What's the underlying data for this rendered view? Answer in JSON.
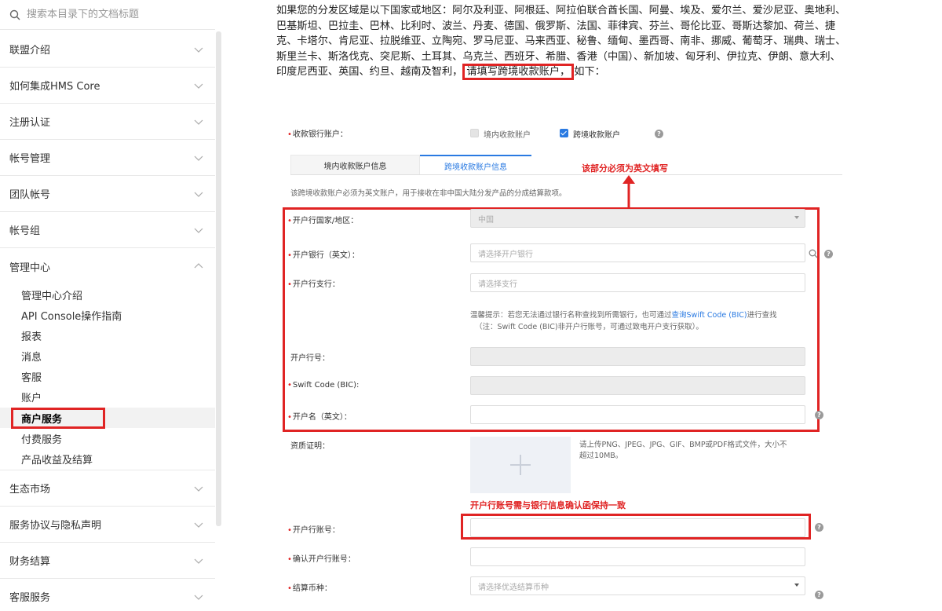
{
  "sidebar": {
    "search_placeholder": "搜索本目录下的文档标题",
    "items": [
      {
        "label": "联盟介绍"
      },
      {
        "label": "如何集成HMS Core"
      },
      {
        "label": "注册认证"
      },
      {
        "label": "帐号管理"
      },
      {
        "label": "团队帐号"
      },
      {
        "label": "帐号组"
      },
      {
        "label": "管理中心"
      }
    ],
    "sub_items": [
      {
        "label": "管理中心介绍"
      },
      {
        "label": "API Console操作指南"
      },
      {
        "label": "报表"
      },
      {
        "label": "消息"
      },
      {
        "label": "客服"
      },
      {
        "label": "账户"
      },
      {
        "label": "商户服务"
      },
      {
        "label": "付费服务"
      },
      {
        "label": "产品收益及结算"
      }
    ],
    "items_after": [
      {
        "label": "生态市场"
      },
      {
        "label": "服务协议与隐私声明"
      },
      {
        "label": "财务结算"
      },
      {
        "label": "客服服务"
      }
    ]
  },
  "intro": {
    "line1": "如果您的分发区域是以下国家或地区：阿尔及利亚、阿根廷、阿拉伯联合酋长国、阿曼、埃及、爱尔兰、爱沙尼亚、奥地利、",
    "line2": "巴基斯坦、巴拉圭、巴林、比利时、波兰、丹麦、德国、俄罗斯、法国、菲律宾、芬兰、哥伦比亚、哥斯达黎加、荷兰、捷",
    "line3": "克、卡塔尔、肯尼亚、拉脱维亚、立陶宛、罗马尼亚、马来西亚、秘鲁、缅甸、墨西哥、南非、挪威、葡萄牙、瑞典、瑞士、",
    "line4": "斯里兰卡、斯洛伐克、突尼斯、土耳其、乌克兰、西班牙、希腊、香港（中国）、新加坡、匈牙利、伊拉克、伊朗、意大利、",
    "line5_pre": "印度尼西亚、英国、约旦、越南及智利，",
    "line5_hl": "请填写跨境收款账户，",
    "line5_post": "如下："
  },
  "form": {
    "account_label": "收款银行账户：",
    "option_domestic": "境内收款账户",
    "option_cross": "跨境收款账户",
    "tab_domestic": "境内收款账户信息",
    "tab_cross": "跨境收款账户信息",
    "note_english": "该部分必须为英文填写",
    "description": "该跨境收款账户必须为英文账户，用于接收在非中国大陆分发产品的分成结算款项。",
    "country_label": "开户行国家/地区：",
    "country_value": "中国",
    "bank_label": "开户银行（英文）：",
    "bank_placeholder": "请选择开户银行",
    "branch_label": "开户行支行：",
    "branch_placeholder": "请选择支行",
    "tip_line1_pre": "温馨提示：若您无法通过银行名称查找到所需银行，也可通过",
    "tip_link": "查询Swift Code (BIC)",
    "tip_line1_post": "进行查找",
    "tip_line2": "（注：Swift Code (BIC)非开户行账号，可通过致电开户支行获取）。",
    "bank_no_label": "开户行号：",
    "swift_label": "Swift Code (BIC):",
    "holder_label": "开户名（英文）：",
    "qualification_label": "资质证明：",
    "upload_hint_line1": "请上传PNG、JPEG、JPG、GIF、BMP或PDF格式文件，大小不",
    "upload_hint_line2": "超过10MB。",
    "note_account": "开户行账号需与银行信息确认函保持一致",
    "account_no_label": "开户行账号：",
    "confirm_account_label": "确认开户行账号：",
    "currency_label": "结算币种：",
    "currency_placeholder": "请选择优选结算币种",
    "help_glyph": "?"
  },
  "colors": {
    "accent": "#2a7ae2",
    "annotation": "#e02424"
  }
}
